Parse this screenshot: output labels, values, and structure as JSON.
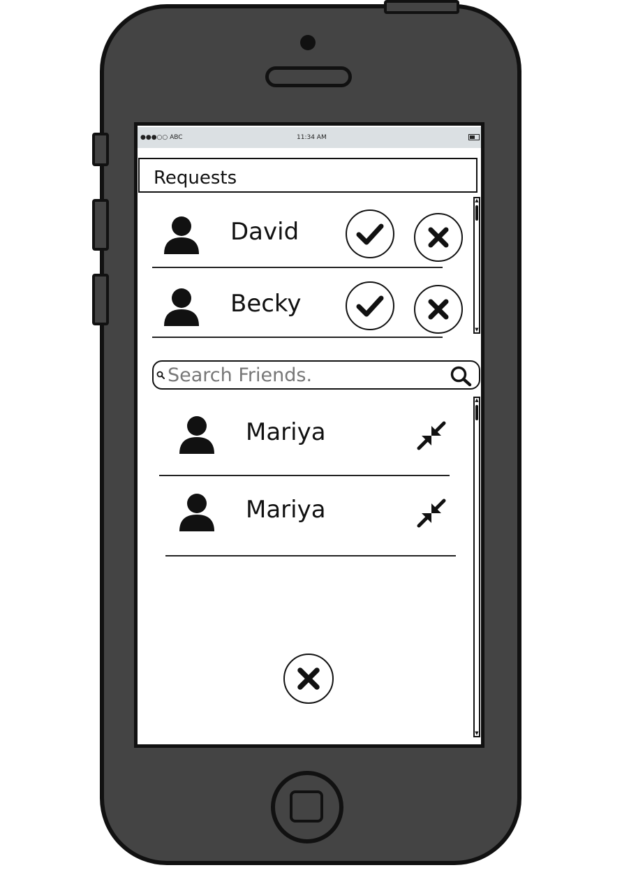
{
  "status_bar": {
    "carrier": "●●●○○ ABC",
    "time": "11:34 AM"
  },
  "requests": {
    "title": "Requests",
    "items": [
      {
        "name": "David"
      },
      {
        "name": "Becky"
      }
    ]
  },
  "search": {
    "placeholder": "Search Friends."
  },
  "friends": {
    "items": [
      {
        "name": "Mariya"
      },
      {
        "name": "Mariya"
      }
    ]
  },
  "icons": {
    "user": "user-icon",
    "accept": "check-icon",
    "decline": "close-icon",
    "collapse": "collapse-arrows-icon",
    "search": "search-icon"
  }
}
